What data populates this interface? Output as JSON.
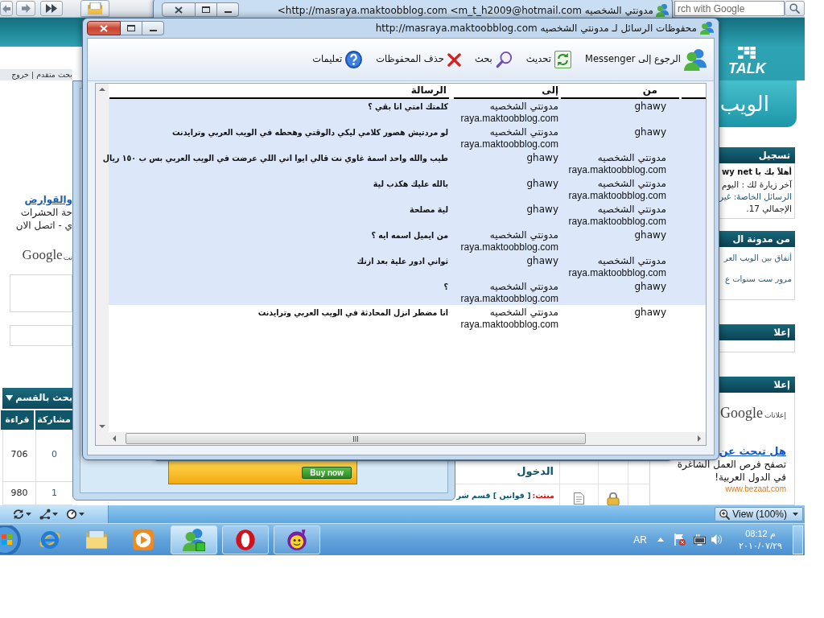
{
  "browser": {
    "search": {
      "placeholder": "rch with Google"
    },
    "top_links": "بحث متقدم | خروج",
    "left_column": {
      "ad_title": "والقوارض",
      "ad_lines": [
        "حة الحشرات",
        "ي - اتصل الان"
      ],
      "ads_brand": "Google",
      "ads_label": "نت",
      "section_table": {
        "title": "بحث بالقسم",
        "columns": [
          "مشاركة",
          "قراءة"
        ],
        "rows": [
          [
            "0",
            "706"
          ],
          [
            "1",
            "980"
          ]
        ]
      }
    },
    "center": {
      "login_label": "الدخول",
      "thread_prefix": "منتث:",
      "thread_title": "[ قوانين ] قسم شر"
    },
    "right_column": {
      "logo_text": "TALK",
      "banner_text": "الويب",
      "panels": [
        {
          "kind": "login",
          "title": "تسجيل",
          "greeting": "أهلاً بك يا wy net",
          "last_visit": "آخر زيارة لك : اليوم",
          "messages": "الرسائل الخاصة: غير",
          "total": "الإجمالي 17."
        },
        {
          "kind": "links",
          "title": "من مدونة ال",
          "links": [
            "أتفاق بين الويب العر",
            "مرور ست سنوات ع"
          ]
        },
        {
          "kind": "empty",
          "title": "إعلا"
        },
        {
          "kind": "ads",
          "title": "إعلا",
          "ads_brand": "Google",
          "ads_label": "إعلانات",
          "ad_title": "هل تبحث عن",
          "ad_lines": [
            "تصفح فرص العمل الشاغرة",
            "في الدول العربية!"
          ],
          "ad_url": "www.bezaat.com"
        }
      ]
    },
    "status_bar": {
      "zoom": "View (100%)"
    }
  },
  "ad_window": {
    "ad_button": "Buy now"
  },
  "conversation_window": {
    "title": "<http://masraya.maktoobblog.com <m_t_h2009@hotmail.com مدونتي الشخصيه"
  },
  "history_dialog": {
    "title": "محفوظات الرسائل لـ مدونتي الشخصيه http://masraya.maktoobblog.com",
    "toolbar": [
      {
        "kind": "messenger",
        "label": "الرجوع إلى Messenger"
      },
      {
        "kind": "refresh",
        "label": "تحديث"
      },
      {
        "kind": "search",
        "label": "بحث"
      },
      {
        "kind": "delete",
        "label": "حذف المحفوظات"
      },
      {
        "kind": "help",
        "label": "تعليمات"
      }
    ],
    "columns": [
      "من",
      "إلى",
      "الرسالة"
    ],
    "rows": [
      {
        "from": {
          "name": "ghawy"
        },
        "to": {
          "name": "مدونتي الشخصيه",
          "address": "raya.maktoobblog.com"
        },
        "message": "كلمتك امتي انا بقي ؟",
        "selected": true
      },
      {
        "from": {
          "name": "ghawy"
        },
        "to": {
          "name": "مدونتي الشخصيه",
          "address": "raya.maktoobblog.com"
        },
        "message": "لو مردتيش هصور كلامي ليكي دالوقتي وهحطه في الويب العربي وترايدنت",
        "selected": true
      },
      {
        "from": {
          "name": "مدونتي الشخصيه",
          "address": "raya.maktoobblog.com"
        },
        "to": {
          "name": "ghawy"
        },
        "message": "طيب والله واحد اسمة غاوي نت قالي ايوا اني اللي عرضت في الويب العربي بس ب ١٥٠ ريال",
        "selected": true
      },
      {
        "from": {
          "name": "مدونتي الشخصيه",
          "address": "raya.maktoobblog.com"
        },
        "to": {
          "name": "ghawy"
        },
        "message": "بالله عليك هكذب لية",
        "selected": true
      },
      {
        "from": {
          "name": "مدونتي الشخصيه",
          "address": "raya.maktoobblog.com"
        },
        "to": {
          "name": "ghawy"
        },
        "message": "لية مصلحة",
        "selected": true
      },
      {
        "from": {
          "name": "ghawy"
        },
        "to": {
          "name": "مدونتي الشخصيه",
          "address": "raya.maktoobblog.com"
        },
        "message": "من ايميل اسمه ايه ؟",
        "selected": true
      },
      {
        "from": {
          "name": "مدونتي الشخصيه",
          "address": "raya.maktoobblog.com"
        },
        "to": {
          "name": "ghawy"
        },
        "message": "ثواني ادور علية بعد ازنك",
        "selected": true
      },
      {
        "from": {
          "name": "ghawy"
        },
        "to": {
          "name": "مدونتي الشخصيه",
          "address": "raya.maktoobblog.com"
        },
        "message": "؟",
        "selected": true
      },
      {
        "from": {
          "name": "ghawy"
        },
        "to": {
          "name": "مدونتي الشخصيه",
          "address": "raya.maktoobblog.com"
        },
        "message": "انا مضطر انزل المحادثة في الويب العربي وترايدنت",
        "selected": false
      }
    ]
  },
  "taskbar": {
    "apps": [
      {
        "kind": "ie",
        "running": false,
        "selected": false
      },
      {
        "kind": "explorer",
        "running": false,
        "selected": false
      },
      {
        "kind": "media",
        "running": false,
        "selected": false
      },
      {
        "kind": "messenger",
        "running": true,
        "selected": true
      },
      {
        "kind": "opera",
        "running": true,
        "selected": false
      },
      {
        "kind": "yahoo",
        "running": true,
        "selected": false
      }
    ],
    "language": "AR",
    "time": "08:12 م",
    "date": "٢٠١٠/٠٧/٢٩"
  }
}
